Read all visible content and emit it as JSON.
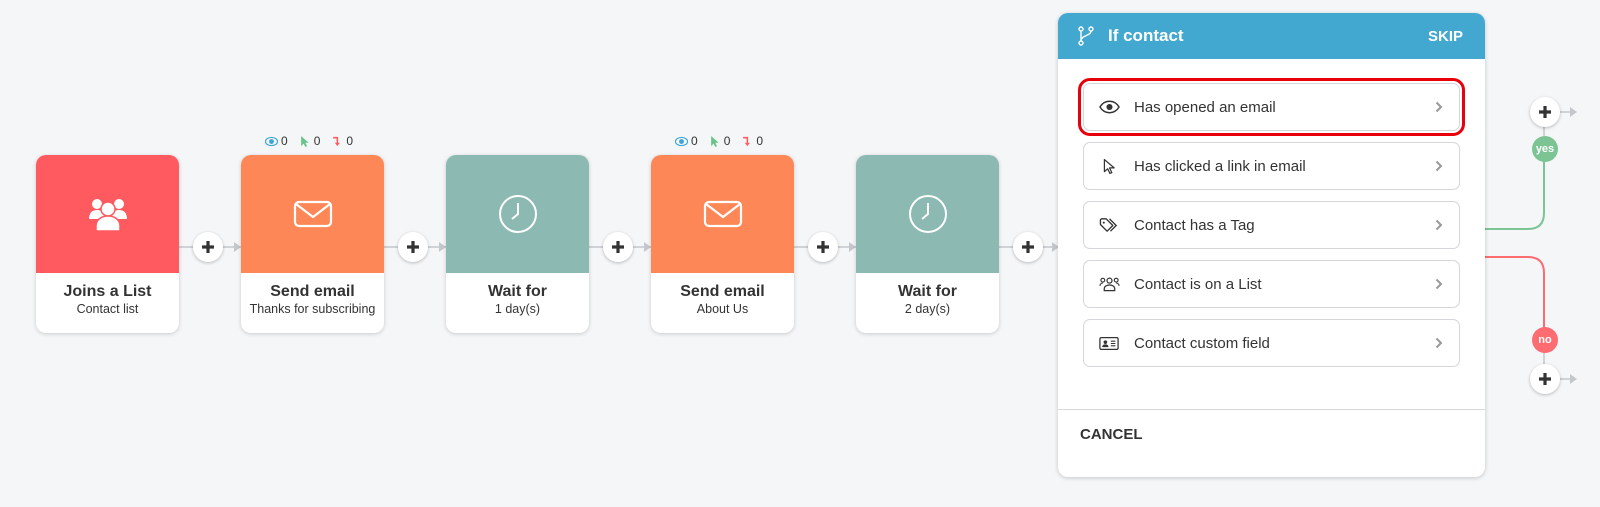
{
  "workflow": {
    "nodes": [
      {
        "type": "trigger",
        "icon": "users-icon",
        "title": "Joins a List",
        "subtitle": "Contact list",
        "color": "#fe5a5f"
      },
      {
        "type": "email",
        "icon": "envelope-icon",
        "title": "Send email",
        "subtitle": "Thanks for subscribing",
        "color": "#fe8757",
        "stats": {
          "opens": "0",
          "clicks": "0",
          "bounces": "0"
        }
      },
      {
        "type": "wait",
        "icon": "clock-icon",
        "title": "Wait for",
        "subtitle": "1 day(s)",
        "color": "#8cb9b1"
      },
      {
        "type": "email",
        "icon": "envelope-icon",
        "title": "Send email",
        "subtitle": "About Us",
        "color": "#fe8757",
        "stats": {
          "opens": "0",
          "clicks": "0",
          "bounces": "0"
        }
      },
      {
        "type": "wait",
        "icon": "clock-icon",
        "title": "Wait for",
        "subtitle": "2 day(s)",
        "color": "#8cb9b1"
      }
    ],
    "branches": {
      "yes_label": "yes",
      "no_label": "no"
    }
  },
  "panel": {
    "title": "If contact",
    "skip_label": "SKIP",
    "cancel_label": "CANCEL",
    "header_color": "#43a8d0",
    "options": [
      {
        "icon": "eye-icon",
        "label": "Has opened an email",
        "highlighted": true
      },
      {
        "icon": "cursor-icon",
        "label": "Has clicked a link in email"
      },
      {
        "icon": "tag-icon",
        "label": "Contact has a Tag"
      },
      {
        "icon": "users-icon",
        "label": "Contact is on a List"
      },
      {
        "icon": "id-card-icon",
        "label": "Contact custom field"
      }
    ]
  }
}
